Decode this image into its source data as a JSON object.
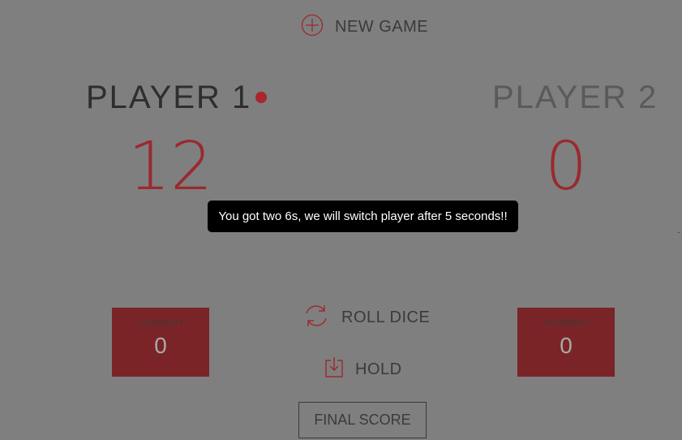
{
  "controls": {
    "new_game_label": "NEW GAME",
    "roll_dice_label": "ROLL DICE",
    "hold_label": "HOLD",
    "final_score_label": "FINAL SCORE"
  },
  "players": [
    {
      "name": "PLAYER 1",
      "score": "12",
      "current_label": "CURRENT",
      "current_value": "0",
      "active": true
    },
    {
      "name": "PLAYER 2",
      "score": "0",
      "current_label": "CURRENT",
      "current_value": "0",
      "active": false
    }
  ],
  "message": "You got two 6s, we will switch player after 5 seconds!!",
  "colors": {
    "background": "#7f7f7f",
    "accent": "#a8262c",
    "current_box": "#7a2428",
    "toast_bg": "#000000"
  },
  "icons": {
    "new_game": "plus-circle-icon",
    "roll_dice": "refresh-icon",
    "hold": "download-tray-icon",
    "active_player": "active-dot-icon"
  }
}
